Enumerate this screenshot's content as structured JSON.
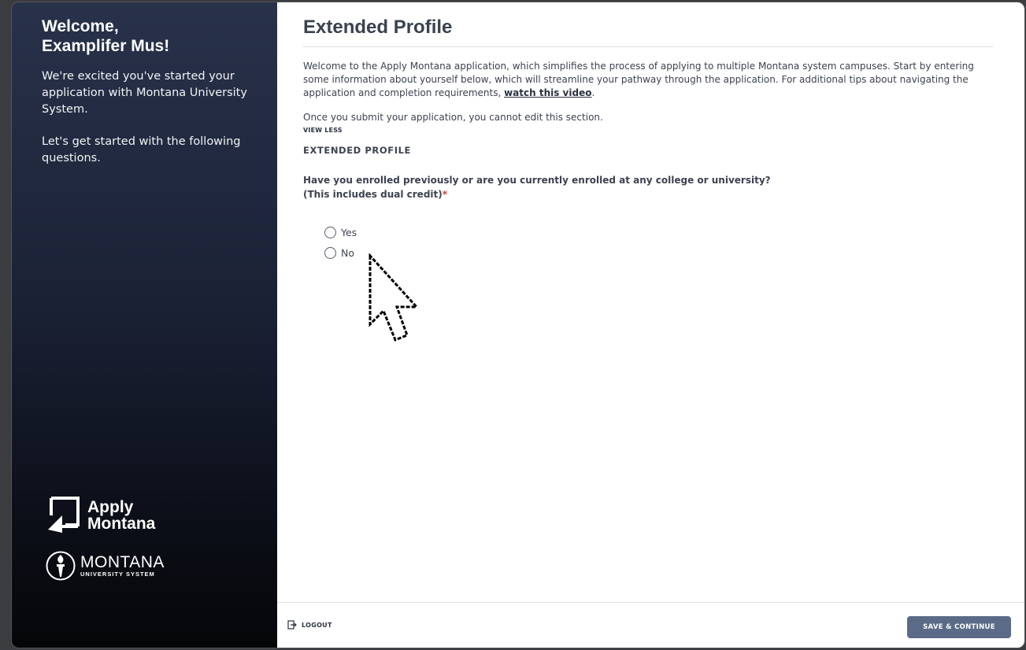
{
  "sidebar": {
    "welcome": "Welcome,",
    "user_name": "Examplifer Mus!",
    "message": "We're excited you've started your application with Montana University System.",
    "prompt": "Let's get started with the following questions.",
    "apply_logo_line1": "Apply",
    "apply_logo_line2": "Montana",
    "mus_logo_name": "MONTANA",
    "mus_logo_sub": "UNIVERSITY SYSTEM"
  },
  "main": {
    "title": "Extended Profile",
    "intro": "Welcome to the Apply Montana application, which simplifies the process of applying to multiple Montana system campuses. Start by entering some information about yourself below, which will streamline your pathway through the application. For additional tips about navigating the application and completion requirements, ",
    "video_link": "watch this video",
    "intro_end": ".",
    "note": "Once you submit your application, you cannot edit this section.",
    "view_less": "VIEW LESS",
    "section_heading": "EXTENDED PROFILE",
    "question": "Have you enrolled previously or are you currently enrolled at any college or university? (This includes dual credit)",
    "required_mark": "*",
    "options": [
      {
        "label": "Yes"
      },
      {
        "label": "No"
      }
    ]
  },
  "footer": {
    "logout_label": "LOGOUT",
    "save_label": "SAVE & CONTINUE"
  },
  "colors": {
    "button": "#5b6b87",
    "required": "#d33a3a",
    "text": "#3c4250"
  }
}
